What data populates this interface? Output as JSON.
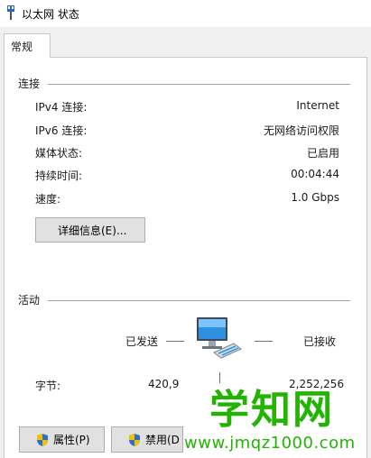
{
  "window": {
    "title": "以太网 状态"
  },
  "tabs": [
    {
      "label": "常规"
    }
  ],
  "connection": {
    "section_title": "连接",
    "rows": [
      {
        "label": "IPv4 连接:",
        "value": "Internet"
      },
      {
        "label": "IPv6 连接:",
        "value": "无网络访问权限"
      },
      {
        "label": "媒体状态:",
        "value": "已启用"
      },
      {
        "label": "持续时间:",
        "value": "00:04:44"
      },
      {
        "label": "速度:",
        "value": "1.0 Gbps"
      }
    ],
    "details_button": "详细信息(E)..."
  },
  "activity": {
    "section_title": "活动",
    "sent_label": "已发送",
    "received_label": "已接收",
    "bytes_label": "字节:",
    "bytes_sent": "420,9",
    "bytes_received": "2,252,256"
  },
  "buttons": {
    "properties": "属性(P)",
    "disable": "禁用(D"
  },
  "watermark": {
    "text": "学知网",
    "url": "www.jmqz1000.com"
  },
  "icons": {
    "title": "network-adapter-icon",
    "activity": "network-computer-icon",
    "shield": "uac-shield-icon"
  }
}
